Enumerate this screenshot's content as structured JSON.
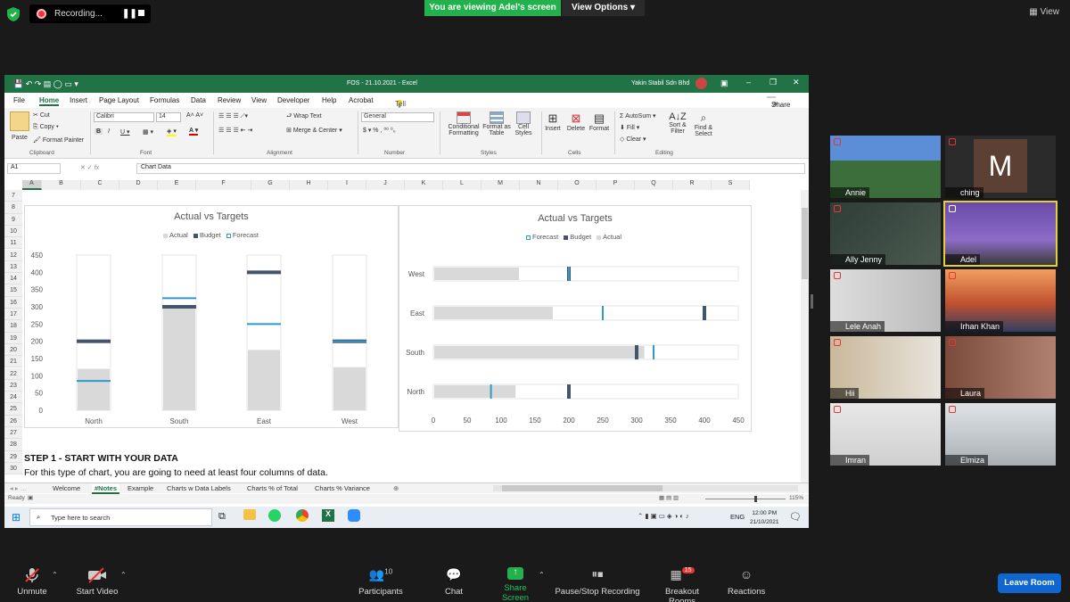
{
  "zoom": {
    "recording": "Recording...",
    "viewing": "You are viewing Adel's screen",
    "view_options": "View Options",
    "view_btn": "View",
    "toolbar": {
      "unmute": "Unmute",
      "start_video": "Start Video",
      "participants": "Participants",
      "participants_count": "10",
      "chat": "Chat",
      "share_screen": "Share Screen",
      "pause_recording": "Pause/Stop Recording",
      "breakout": "Breakout Rooms",
      "breakout_badge": "15",
      "reactions": "Reactions",
      "leave": "Leave Room"
    },
    "participants": [
      "Annie",
      "ching",
      "Ally Jenny",
      "Adel",
      "Lele Anah",
      "Irhan Khan",
      "Hii",
      "Laura",
      "Imran",
      "Elmiza"
    ],
    "avatar_letter": "M"
  },
  "excel": {
    "title": "FOS - 21.10.2021 - Excel",
    "user": "Yakin Stabil Sdn Bhd",
    "tabs": [
      "File",
      "Home",
      "Insert",
      "Page Layout",
      "Formulas",
      "Data",
      "Review",
      "View",
      "Developer",
      "Help",
      "Acrobat"
    ],
    "tell_me": "Tell me what you want to do",
    "share": "Share",
    "ribbon": {
      "paste": "Paste",
      "cut": "Cut",
      "copy": "Copy",
      "format_painter": "Format Painter",
      "clipboard": "Clipboard",
      "font_name": "Calibri",
      "font_size": "14",
      "font": "Font",
      "wrap_text": "Wrap Text",
      "merge_center": "Merge & Center",
      "alignment": "Alignment",
      "number_format": "General",
      "number": "Number",
      "conditional": "Conditional Formatting",
      "format_table": "Format as Table",
      "cell_styles": "Cell Styles",
      "styles": "Styles",
      "insert": "Insert",
      "delete": "Delete",
      "format": "Format",
      "cells": "Cells",
      "autosum": "AutoSum",
      "fill": "Fill",
      "clear": "Clear",
      "sort_filter": "Sort & Filter",
      "find_select": "Find & Select",
      "editing": "Editing"
    },
    "name_box": "A1",
    "formula": "Chart Data",
    "columns": [
      "A",
      "B",
      "C",
      "D",
      "E",
      "F",
      "G",
      "H",
      "I",
      "J",
      "K",
      "L",
      "M",
      "N",
      "O",
      "P",
      "Q",
      "R",
      "S"
    ],
    "rows": [
      "7",
      "8",
      "9",
      "10",
      "11",
      "12",
      "13",
      "14",
      "15",
      "16",
      "17",
      "18",
      "19",
      "20",
      "21",
      "22",
      "23",
      "24",
      "25",
      "26",
      "27",
      "28",
      "29",
      "30"
    ],
    "step_heading": "STEP 1 - START WITH YOUR DATA",
    "step_text": "For this type of chart, you are going to need at least four columns of data.",
    "sheets": [
      "Welcome",
      "#Notes",
      "Example",
      "Charts w Data Labels",
      "Charts % of Total",
      "Charts % Variance"
    ],
    "status_ready": "Ready",
    "zoom_pct": "115%"
  },
  "taskbar": {
    "search": "Type here to search",
    "time": "12:00 PM",
    "date": "21/10/2021",
    "lang": "ENG"
  },
  "chart_data": [
    {
      "type": "bar",
      "title": "Actual vs Targets",
      "legend": [
        "Actual",
        "Budget",
        "Forecast"
      ],
      "categories": [
        "North",
        "South",
        "East",
        "West"
      ],
      "series": [
        {
          "name": "Actual",
          "values": [
            120,
            300,
            175,
            125
          ]
        },
        {
          "name": "Budget",
          "values": [
            200,
            300,
            400,
            200
          ]
        },
        {
          "name": "Forecast",
          "values": [
            85,
            325,
            250,
            200
          ]
        }
      ],
      "ylim": [
        0,
        450
      ],
      "yticks": [
        "0",
        "50",
        "100",
        "150",
        "200",
        "250",
        "300",
        "350",
        "400",
        "450"
      ],
      "colors": {
        "Actual": "#d9d9d9",
        "Budget": "#44546a",
        "Forecast": "#2e9ad0"
      }
    },
    {
      "type": "bar",
      "orientation": "horizontal",
      "title": "Actual vs Targets",
      "legend": [
        "Forecast",
        "Budget",
        "Actual"
      ],
      "categories": [
        "West",
        "East",
        "South",
        "North"
      ],
      "series": [
        {
          "name": "Actual",
          "values": [
            125,
            175,
            310,
            120
          ]
        },
        {
          "name": "Budget",
          "values": [
            200,
            400,
            300,
            200
          ]
        },
        {
          "name": "Forecast",
          "values": [
            200,
            250,
            325,
            85
          ]
        }
      ],
      "xlim": [
        0,
        450
      ],
      "xticks": [
        "0",
        "50",
        "100",
        "150",
        "200",
        "250",
        "300",
        "350",
        "400",
        "450"
      ],
      "colors": {
        "Actual": "#d9d9d9",
        "Budget": "#44546a",
        "Forecast": "#2e9ad0"
      }
    }
  ]
}
